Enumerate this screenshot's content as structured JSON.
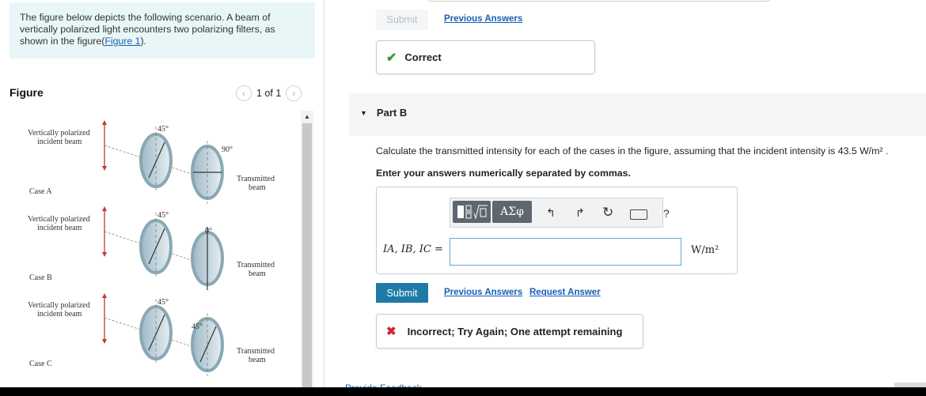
{
  "intro": {
    "text": "The figure below depicts the following scenario. A beam of vertically polarized light encounters two polarizing filters, as shown in the figure(",
    "link": "Figure 1",
    "suffix": ")."
  },
  "figure": {
    "title": "Figure",
    "pager": "1 of 1",
    "cases": [
      {
        "incident": [
          "Vertically polarized",
          "incident beam"
        ],
        "angle1": "45°",
        "angle2": "90°",
        "transmitted": [
          "Transmitted",
          "beam"
        ],
        "name": "Case A"
      },
      {
        "incident": [
          "Vertically polarized",
          "incident beam"
        ],
        "angle1": "45°",
        "angle2": "0°",
        "transmitted": [
          "Transmitted",
          "beam"
        ],
        "name": "Case B"
      },
      {
        "incident": [
          "Vertically polarized",
          "incident beam"
        ],
        "angle1": "45°",
        "angle2": "45°",
        "transmitted": [
          "Transmitted",
          "beam"
        ],
        "name": "Case C"
      }
    ]
  },
  "part_a": {
    "submit_label": "Submit",
    "previous_answers": "Previous Answers",
    "status": "Correct"
  },
  "part_b": {
    "label": "Part B",
    "question": "Calculate the transmitted intensity for each of the cases in the figure, assuming that the incident intensity is 43.5 W/m² .",
    "instructions": "Enter your answers numerically separated by commas.",
    "answer_label": "IA, IB, IC =",
    "answer_value": "",
    "unit": "W/m²",
    "toolbar": {
      "sym1": "ΑΣφ",
      "help": "?"
    },
    "submit_label": "Submit",
    "previous_answers": "Previous Answers",
    "request_answer": "Request Answer",
    "feedback": "Incorrect; Try Again; One attempt remaining"
  },
  "footer": {
    "provide_feedback": "Provide Feedback"
  },
  "colors": {
    "accent": "#1f7aa8",
    "link": "#1a5fb4",
    "correct": "#3a9a2e",
    "incorrect": "#d0262d"
  }
}
